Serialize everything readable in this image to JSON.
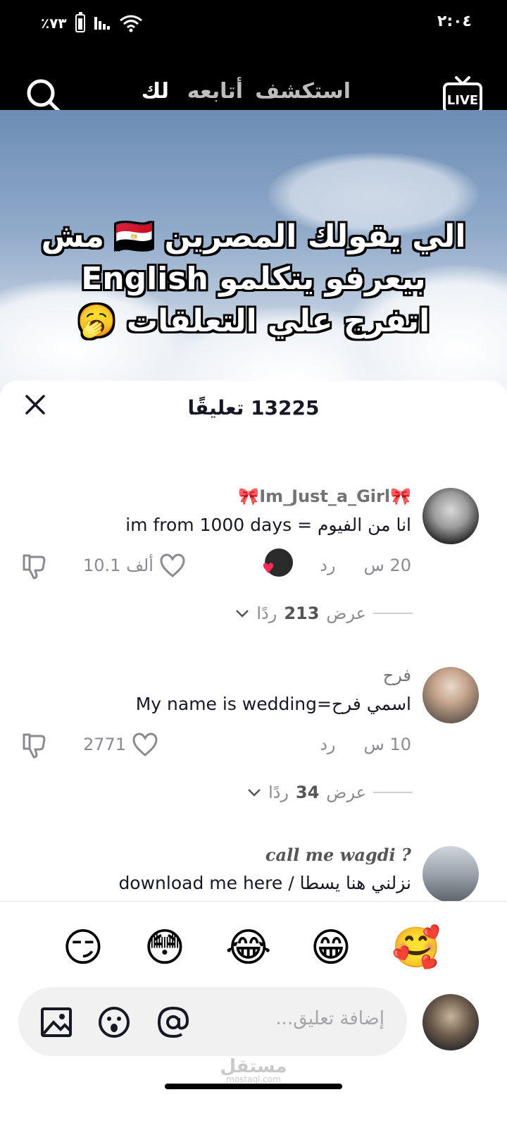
{
  "status_bar": {
    "time": "٢:٠٤",
    "battery": "٪٧٣"
  },
  "nav": {
    "tabs": [
      {
        "label": "لك",
        "active": true
      },
      {
        "label": "أتابعه",
        "active": false
      },
      {
        "label": "استكشف",
        "active": false
      }
    ],
    "live_label": "LIVE"
  },
  "video": {
    "caption_lines": [
      "الي يقولك المصرين 🇪🇬 مش",
      "بيعرفو يتكلمو English",
      "اتفرج علي التعلقات 🥱"
    ]
  },
  "comments_sheet": {
    "title": "13225 تعليقًا",
    "comments": [
      {
        "username": "🎀Im_Just_a_Girl🎀",
        "text": "انا من الفيوم = im from 1000 days",
        "age": "20 س",
        "reply_label": "رد",
        "likes": "10.1 ألف",
        "liked_by_creator": true,
        "view_replies": {
          "prefix": "عرض",
          "count": "213",
          "suffix": "ردًا"
        }
      },
      {
        "username": "فرح",
        "text": "اسمي فرح=My name is wedding",
        "age": "10 س",
        "reply_label": "رد",
        "likes": "2771",
        "liked_by_creator": false,
        "view_replies": {
          "prefix": "عرض",
          "count": "34",
          "suffix": "ردًا"
        }
      },
      {
        "username": "? call me wagdi",
        "text": "نزلني هنا يسطا / download me here"
      }
    ]
  },
  "emoji_bar": [
    "🥰",
    "😁",
    "😂",
    "😳",
    "😏"
  ],
  "input": {
    "placeholder": "إضافة تعليق..."
  },
  "watermark": {
    "main": "مستقل",
    "sub": "mostaql.com"
  },
  "colors": {
    "like_red": "#fe2c55",
    "text_primary": "#161823",
    "text_secondary": "#8a8b91"
  }
}
